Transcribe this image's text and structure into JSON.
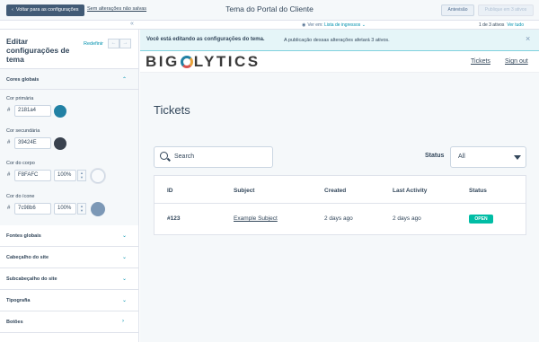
{
  "topbar": {
    "back_label": "Voltar para as configurações",
    "unsaved_label": "Sem alterações não salvas",
    "title": "Tema do Portal do Cliente",
    "preview_label": "Antevisão",
    "publish_label": "Publique em 3 ativos"
  },
  "subbar": {
    "viewing_label": "Ver em:",
    "viewing_value": "Lista de ingressos",
    "count_text": "1 de 3 ativos",
    "view_all": "Ver tudo"
  },
  "sidebar": {
    "title": "Editar configurações de tema",
    "reset_label": "Redefinir",
    "global_colors": {
      "heading": "Cores globais",
      "fields": [
        {
          "label": "Cor primária",
          "hex": "2181a4",
          "color": "#2181a4"
        },
        {
          "label": "Cor secundária",
          "hex": "39424E",
          "color": "#39424e"
        },
        {
          "label": "Cor do corpo",
          "hex": "F8FAFC",
          "opacity": "100%",
          "color": "#f8fafc"
        },
        {
          "label": "Cor do ícone",
          "hex": "7c98b6",
          "opacity": "100%",
          "color": "#7c98b6"
        }
      ]
    },
    "sections": [
      {
        "label": "Fontes globais"
      },
      {
        "label": "Cabeçalho do site"
      },
      {
        "label": "Subcabeçalho do site"
      },
      {
        "label": "Tipografia"
      },
      {
        "label": "Botões"
      }
    ]
  },
  "banner": {
    "bold": "Você está editando as configurações do tema.",
    "text": "A publicação dessas alterações afetará 3 ativos."
  },
  "portal": {
    "logo": "BIGLYTICS",
    "nav": [
      "Tickets",
      "Sign out"
    ],
    "heading": "Tickets",
    "search_placeholder": "Search",
    "status_label": "Status",
    "status_value": "All",
    "table": {
      "headers": [
        "ID",
        "Subject",
        "Created",
        "Last Activity",
        "Status"
      ],
      "rows": [
        {
          "id": "#123",
          "subject": "Example Subject",
          "created": "2 days ago",
          "last_activity": "2 days ago",
          "status": "OPEN"
        }
      ]
    }
  }
}
